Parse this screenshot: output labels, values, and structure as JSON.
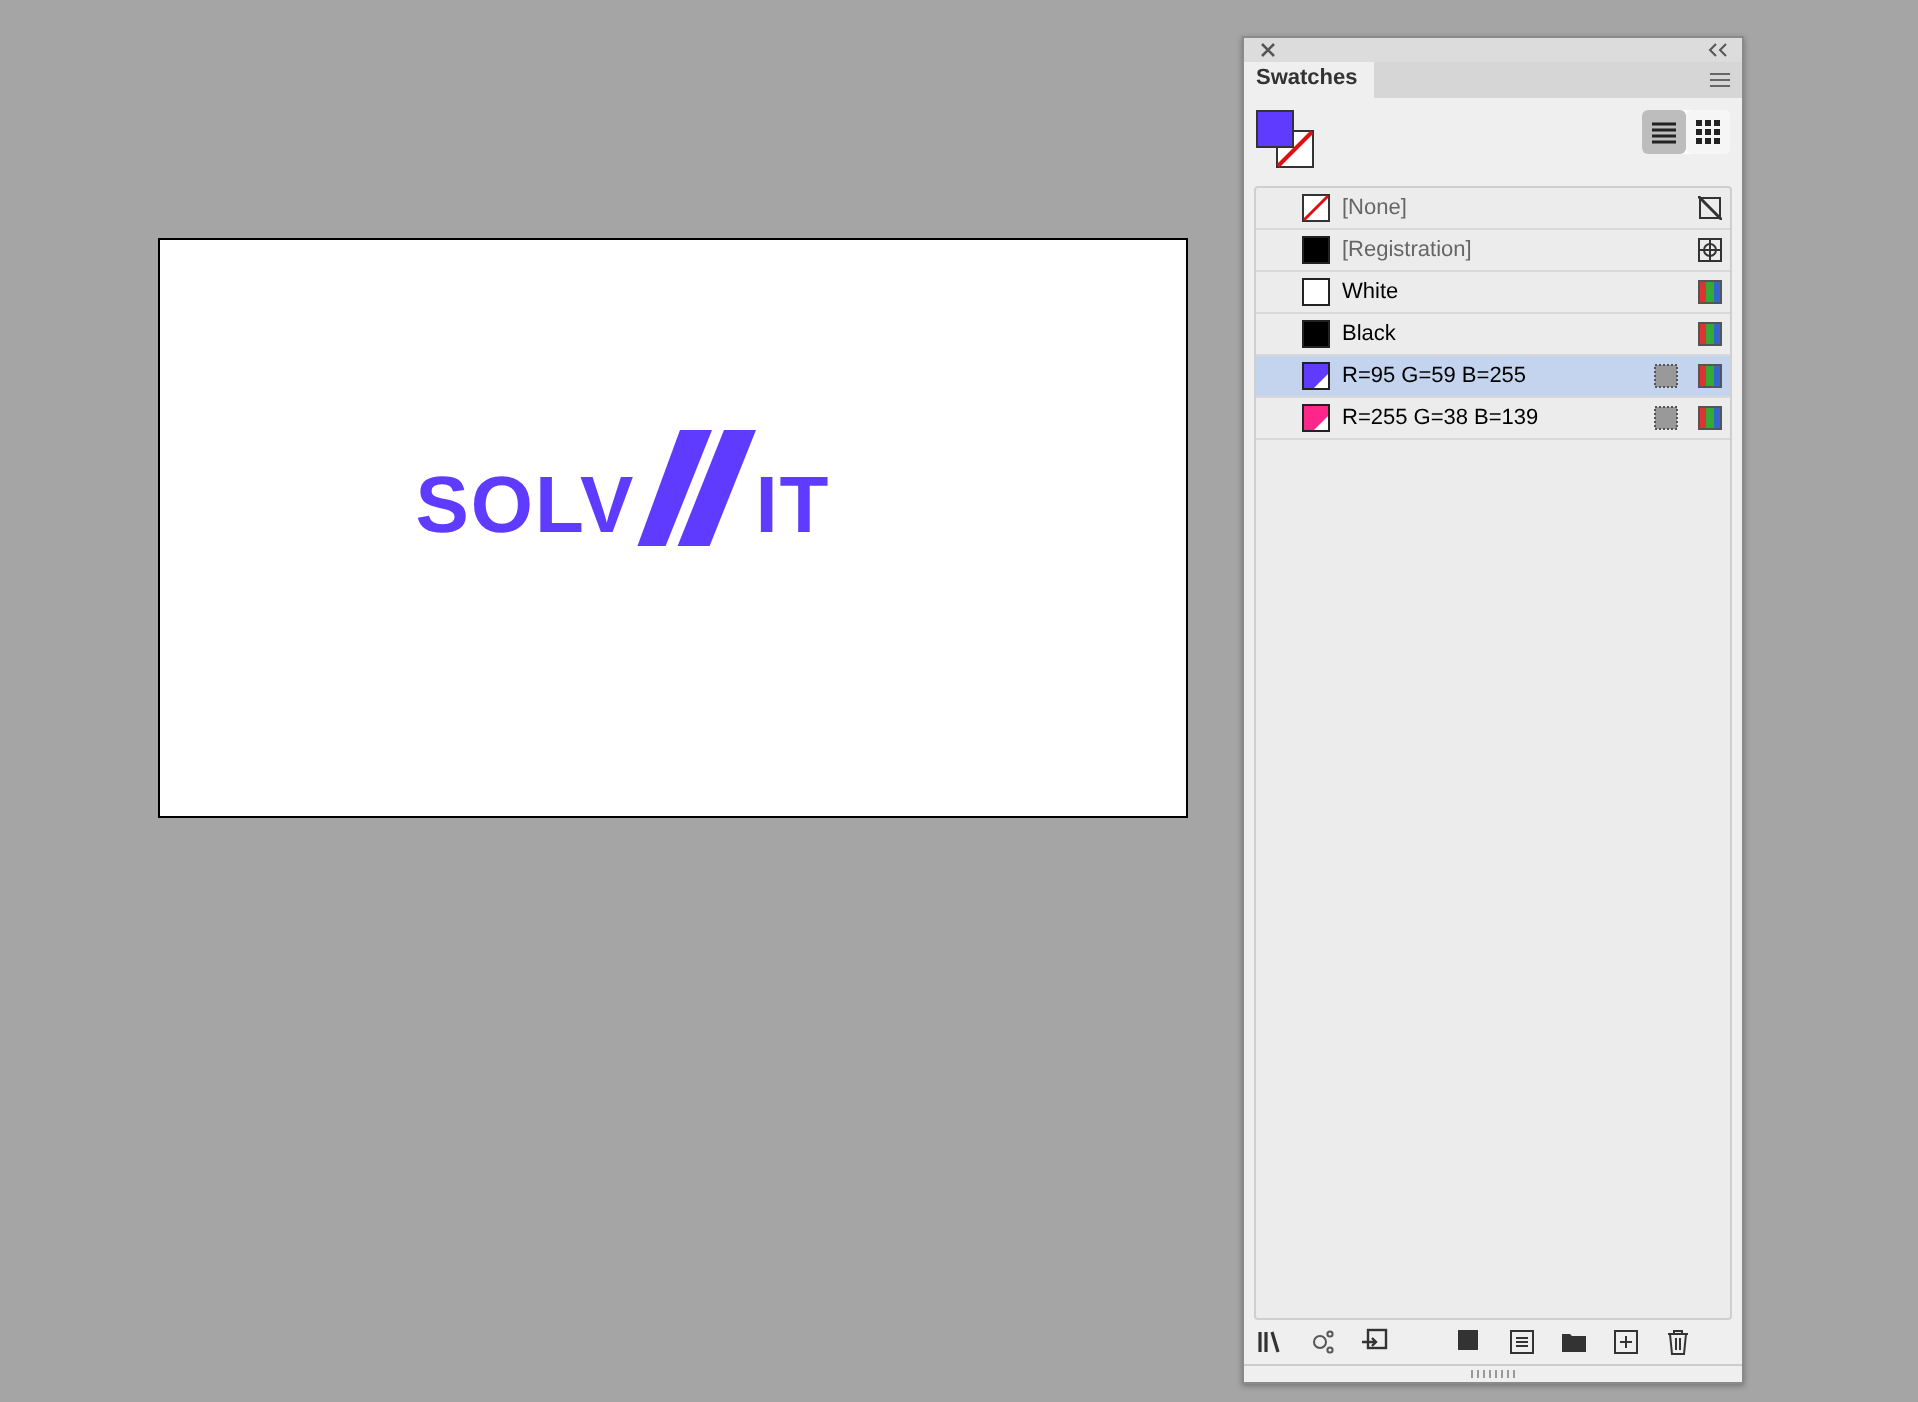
{
  "artboard": {
    "logo": {
      "left_text": "SOLV",
      "right_text": "IT",
      "color": "#5f3bff"
    }
  },
  "panel": {
    "tab": "Swatches",
    "views": [
      {
        "kind": "list",
        "selected": true
      },
      {
        "kind": "grid",
        "selected": false
      }
    ],
    "swatches": [
      {
        "name": "[None]",
        "kind": "none",
        "locked": true,
        "selected": false,
        "global": false
      },
      {
        "name": "[Registration]",
        "kind": "registration",
        "color": "#000000",
        "locked": true,
        "selected": false,
        "global": false
      },
      {
        "name": "White",
        "kind": "process",
        "color": "#ffffff",
        "locked": false,
        "selected": false,
        "global": false
      },
      {
        "name": "Black",
        "kind": "process",
        "color": "#000000",
        "locked": false,
        "selected": false,
        "global": false
      },
      {
        "name": "R=95 G=59 B=255",
        "kind": "process",
        "color": "#5f3bff",
        "locked": false,
        "selected": true,
        "global": true
      },
      {
        "name": "R=255 G=38 B=139",
        "kind": "process",
        "color": "#ff268b",
        "locked": false,
        "selected": false,
        "global": true
      }
    ]
  }
}
